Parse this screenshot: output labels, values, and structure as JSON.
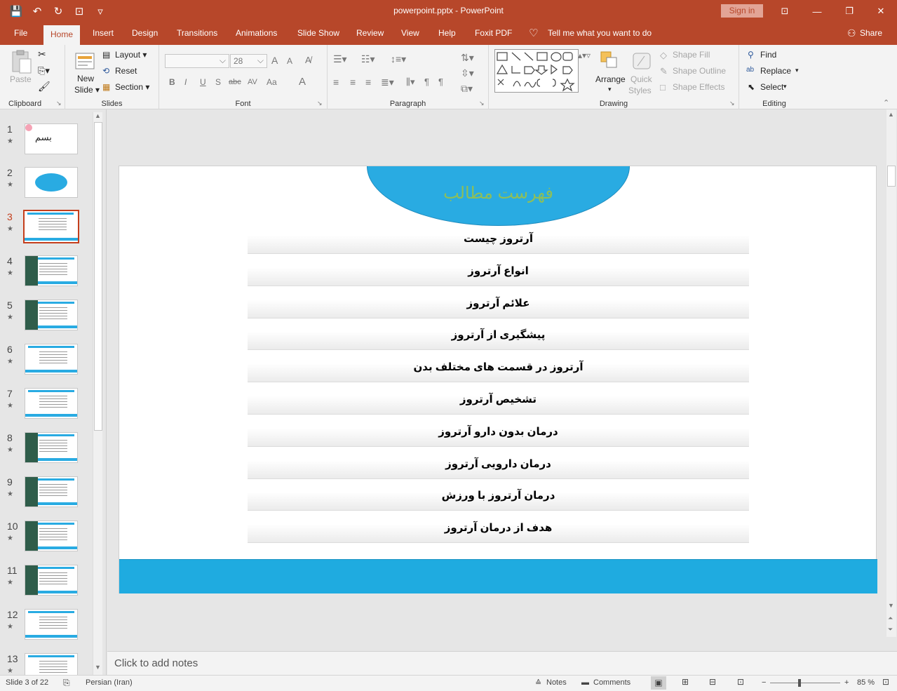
{
  "window": {
    "title": "powerpoint.pptx  -  PowerPoint",
    "signin": "Sign in",
    "minimize": "—",
    "restore": "❐",
    "close": "✕",
    "ribbon_display": "⊡"
  },
  "qat": {
    "save": "💾",
    "undo": "↶",
    "redo": "↻",
    "present": "⊡",
    "customize": "▿"
  },
  "tabs": [
    {
      "label": "File"
    },
    {
      "label": "Home"
    },
    {
      "label": "Insert"
    },
    {
      "label": "Design"
    },
    {
      "label": "Transitions"
    },
    {
      "label": "Animations"
    },
    {
      "label": "Slide Show"
    },
    {
      "label": "Review"
    },
    {
      "label": "View"
    },
    {
      "label": "Help"
    },
    {
      "label": "Foxit PDF"
    }
  ],
  "tell_me": "Tell me what you want to do",
  "share": "Share",
  "ribbon": {
    "clipboard": {
      "label": "Clipboard",
      "paste": "Paste"
    },
    "slides": {
      "label": "Slides",
      "new_slide_1": "New",
      "new_slide_2": "Slide ▾",
      "layout": "Layout ▾",
      "reset": "Reset",
      "section": "Section ▾"
    },
    "font": {
      "label": "Font",
      "size": "28",
      "bold": "B",
      "italic": "I",
      "underline": "U",
      "shadow": "S",
      "strike": "abc",
      "spacing": "AV",
      "case": "Aa",
      "color": "A",
      "grow": "A",
      "shrink": "A"
    },
    "paragraph": {
      "label": "Paragraph"
    },
    "drawing": {
      "label": "Drawing",
      "arrange": "Arrange",
      "quick_styles_1": "Quick",
      "quick_styles_2": "Styles",
      "shape_fill": "Shape Fill",
      "shape_outline": "Shape Outline",
      "shape_effects": "Shape Effects"
    },
    "editing": {
      "label": "Editing",
      "find": "Find",
      "replace": "Replace",
      "select": "Select"
    }
  },
  "thumbnails": [
    {
      "num": "1"
    },
    {
      "num": "2"
    },
    {
      "num": "3"
    },
    {
      "num": "4"
    },
    {
      "num": "5"
    },
    {
      "num": "6"
    },
    {
      "num": "7"
    },
    {
      "num": "8"
    },
    {
      "num": "9"
    },
    {
      "num": "10"
    },
    {
      "num": "11"
    },
    {
      "num": "12"
    },
    {
      "num": "13"
    }
  ],
  "selected_slide": 3,
  "slide": {
    "title": "فهرست مطالب",
    "items": [
      "آرتروز چیست",
      "انواع آرتروز",
      "علائم آرتروز",
      "پیشگیری از آرتروز",
      "آرتروز در قسمت های مختلف بدن",
      "تشخیص آرتروز",
      "درمان بدون دارو آرتروز",
      "درمان دارویی آرتروز",
      "درمان آرتروز با ورزش",
      "هدف از درمان آرتروز"
    ],
    "colors": {
      "accent": "#1fabe0",
      "title": "#8dbf5a",
      "app": "#b7472a"
    }
  },
  "notes_placeholder": "Click to add notes",
  "status": {
    "slide_of": "Slide 3 of 22",
    "language": "Persian (Iran)",
    "notes": "Notes",
    "comments": "Comments",
    "zoom": "85 %",
    "zoom_level": 85
  }
}
